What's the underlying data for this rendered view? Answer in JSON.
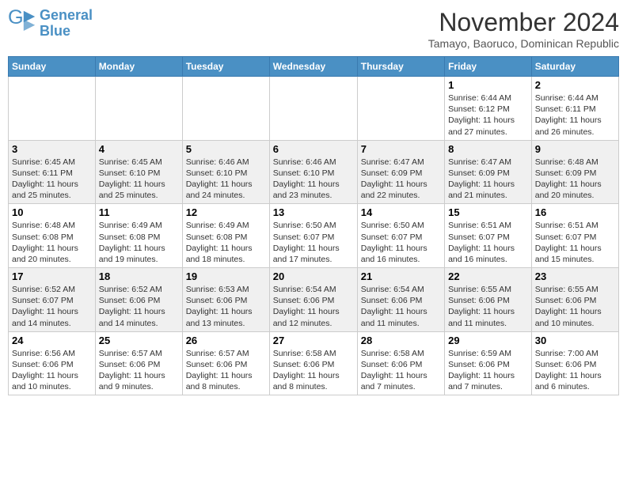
{
  "logo": {
    "text_general": "General",
    "text_blue": "Blue"
  },
  "title": "November 2024",
  "location": "Tamayo, Baoruco, Dominican Republic",
  "days_of_week": [
    "Sunday",
    "Monday",
    "Tuesday",
    "Wednesday",
    "Thursday",
    "Friday",
    "Saturday"
  ],
  "weeks": [
    [
      {
        "day": "",
        "info": ""
      },
      {
        "day": "",
        "info": ""
      },
      {
        "day": "",
        "info": ""
      },
      {
        "day": "",
        "info": ""
      },
      {
        "day": "",
        "info": ""
      },
      {
        "day": "1",
        "info": "Sunrise: 6:44 AM\nSunset: 6:12 PM\nDaylight: 11 hours and 27 minutes."
      },
      {
        "day": "2",
        "info": "Sunrise: 6:44 AM\nSunset: 6:11 PM\nDaylight: 11 hours and 26 minutes."
      }
    ],
    [
      {
        "day": "3",
        "info": "Sunrise: 6:45 AM\nSunset: 6:11 PM\nDaylight: 11 hours and 25 minutes."
      },
      {
        "day": "4",
        "info": "Sunrise: 6:45 AM\nSunset: 6:10 PM\nDaylight: 11 hours and 25 minutes."
      },
      {
        "day": "5",
        "info": "Sunrise: 6:46 AM\nSunset: 6:10 PM\nDaylight: 11 hours and 24 minutes."
      },
      {
        "day": "6",
        "info": "Sunrise: 6:46 AM\nSunset: 6:10 PM\nDaylight: 11 hours and 23 minutes."
      },
      {
        "day": "7",
        "info": "Sunrise: 6:47 AM\nSunset: 6:09 PM\nDaylight: 11 hours and 22 minutes."
      },
      {
        "day": "8",
        "info": "Sunrise: 6:47 AM\nSunset: 6:09 PM\nDaylight: 11 hours and 21 minutes."
      },
      {
        "day": "9",
        "info": "Sunrise: 6:48 AM\nSunset: 6:09 PM\nDaylight: 11 hours and 20 minutes."
      }
    ],
    [
      {
        "day": "10",
        "info": "Sunrise: 6:48 AM\nSunset: 6:08 PM\nDaylight: 11 hours and 20 minutes."
      },
      {
        "day": "11",
        "info": "Sunrise: 6:49 AM\nSunset: 6:08 PM\nDaylight: 11 hours and 19 minutes."
      },
      {
        "day": "12",
        "info": "Sunrise: 6:49 AM\nSunset: 6:08 PM\nDaylight: 11 hours and 18 minutes."
      },
      {
        "day": "13",
        "info": "Sunrise: 6:50 AM\nSunset: 6:07 PM\nDaylight: 11 hours and 17 minutes."
      },
      {
        "day": "14",
        "info": "Sunrise: 6:50 AM\nSunset: 6:07 PM\nDaylight: 11 hours and 16 minutes."
      },
      {
        "day": "15",
        "info": "Sunrise: 6:51 AM\nSunset: 6:07 PM\nDaylight: 11 hours and 16 minutes."
      },
      {
        "day": "16",
        "info": "Sunrise: 6:51 AM\nSunset: 6:07 PM\nDaylight: 11 hours and 15 minutes."
      }
    ],
    [
      {
        "day": "17",
        "info": "Sunrise: 6:52 AM\nSunset: 6:07 PM\nDaylight: 11 hours and 14 minutes."
      },
      {
        "day": "18",
        "info": "Sunrise: 6:52 AM\nSunset: 6:06 PM\nDaylight: 11 hours and 14 minutes."
      },
      {
        "day": "19",
        "info": "Sunrise: 6:53 AM\nSunset: 6:06 PM\nDaylight: 11 hours and 13 minutes."
      },
      {
        "day": "20",
        "info": "Sunrise: 6:54 AM\nSunset: 6:06 PM\nDaylight: 11 hours and 12 minutes."
      },
      {
        "day": "21",
        "info": "Sunrise: 6:54 AM\nSunset: 6:06 PM\nDaylight: 11 hours and 11 minutes."
      },
      {
        "day": "22",
        "info": "Sunrise: 6:55 AM\nSunset: 6:06 PM\nDaylight: 11 hours and 11 minutes."
      },
      {
        "day": "23",
        "info": "Sunrise: 6:55 AM\nSunset: 6:06 PM\nDaylight: 11 hours and 10 minutes."
      }
    ],
    [
      {
        "day": "24",
        "info": "Sunrise: 6:56 AM\nSunset: 6:06 PM\nDaylight: 11 hours and 10 minutes."
      },
      {
        "day": "25",
        "info": "Sunrise: 6:57 AM\nSunset: 6:06 PM\nDaylight: 11 hours and 9 minutes."
      },
      {
        "day": "26",
        "info": "Sunrise: 6:57 AM\nSunset: 6:06 PM\nDaylight: 11 hours and 8 minutes."
      },
      {
        "day": "27",
        "info": "Sunrise: 6:58 AM\nSunset: 6:06 PM\nDaylight: 11 hours and 8 minutes."
      },
      {
        "day": "28",
        "info": "Sunrise: 6:58 AM\nSunset: 6:06 PM\nDaylight: 11 hours and 7 minutes."
      },
      {
        "day": "29",
        "info": "Sunrise: 6:59 AM\nSunset: 6:06 PM\nDaylight: 11 hours and 7 minutes."
      },
      {
        "day": "30",
        "info": "Sunrise: 7:00 AM\nSunset: 6:06 PM\nDaylight: 11 hours and 6 minutes."
      }
    ]
  ]
}
